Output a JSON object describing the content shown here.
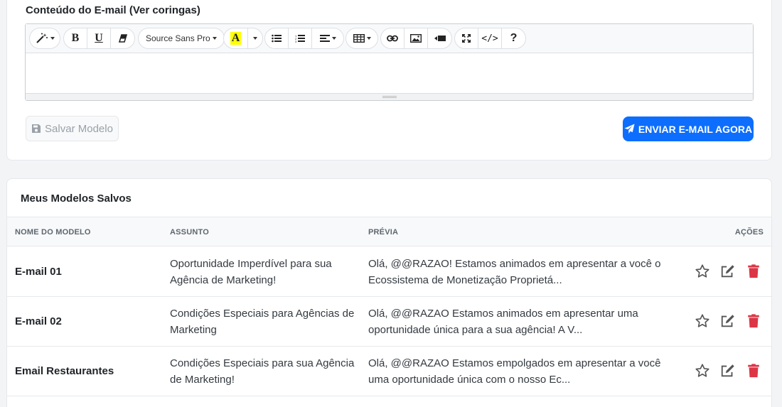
{
  "editor_section": {
    "label": "Conteúdo do E-mail (Ver coringas)",
    "font_select": "Source Sans Pro",
    "toolbar_icons": [
      "magic-icon",
      "bold-icon",
      "underline-icon",
      "eraser-icon",
      "font-family-select",
      "highlight-icon",
      "color-caret-icon",
      "unordered-list-icon",
      "ordered-list-icon",
      "align-icon",
      "table-icon",
      "link-icon",
      "image-icon",
      "video-icon",
      "fullscreen-icon",
      "code-view-icon",
      "help-icon"
    ],
    "save_label": "Salvar Modelo",
    "send_label": "ENVIAR E-MAIL AGORA"
  },
  "saved_templates": {
    "title": "Meus Modelos Salvos",
    "columns": [
      "NOME DO MODELO",
      "ASSUNTO",
      "PRÉVIA",
      "AÇÕES"
    ],
    "rows": [
      {
        "name": "E-mail 01",
        "subject": "Oportunidade Imperdível para sua Agência de Marketing!",
        "preview": "Olá, @@RAZAO! Estamos animados em apresentar a você o Ecossistema de Monetização Proprietá..."
      },
      {
        "name": "E-mail 02",
        "subject": "Condições Especiais para Agências de Marketing",
        "preview": "Olá, @@RAZAO Estamos animados em apresentar uma oportunidade única para a sua agência! A V..."
      },
      {
        "name": "Email Restaurantes",
        "subject": "Condições Especiais para sua Agência de Marketing!",
        "preview": "Olá, @@RAZAO Estamos empolgados em apresentar a você uma oportunidade única com o nosso Ec..."
      }
    ],
    "action_icons": [
      "star-icon",
      "edit-icon",
      "trash-icon"
    ]
  },
  "colors": {
    "primary": "#0d6efd",
    "danger": "#dc3545",
    "highlight": "#ffff00"
  }
}
